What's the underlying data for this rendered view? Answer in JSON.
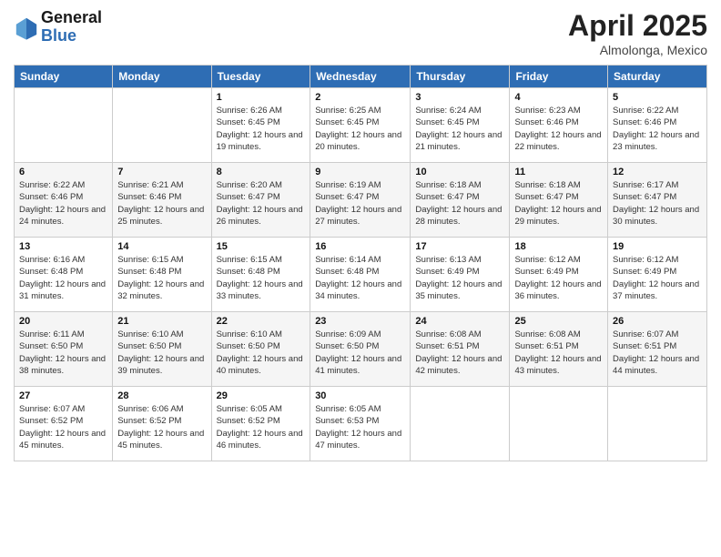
{
  "header": {
    "logo_general": "General",
    "logo_blue": "Blue",
    "month_year": "April 2025",
    "location": "Almolonga, Mexico"
  },
  "days_of_week": [
    "Sunday",
    "Monday",
    "Tuesday",
    "Wednesday",
    "Thursday",
    "Friday",
    "Saturday"
  ],
  "weeks": [
    [
      {
        "day": "",
        "sunrise": "",
        "sunset": "",
        "daylight": ""
      },
      {
        "day": "",
        "sunrise": "",
        "sunset": "",
        "daylight": ""
      },
      {
        "day": "1",
        "sunrise": "Sunrise: 6:26 AM",
        "sunset": "Sunset: 6:45 PM",
        "daylight": "Daylight: 12 hours and 19 minutes."
      },
      {
        "day": "2",
        "sunrise": "Sunrise: 6:25 AM",
        "sunset": "Sunset: 6:45 PM",
        "daylight": "Daylight: 12 hours and 20 minutes."
      },
      {
        "day": "3",
        "sunrise": "Sunrise: 6:24 AM",
        "sunset": "Sunset: 6:45 PM",
        "daylight": "Daylight: 12 hours and 21 minutes."
      },
      {
        "day": "4",
        "sunrise": "Sunrise: 6:23 AM",
        "sunset": "Sunset: 6:46 PM",
        "daylight": "Daylight: 12 hours and 22 minutes."
      },
      {
        "day": "5",
        "sunrise": "Sunrise: 6:22 AM",
        "sunset": "Sunset: 6:46 PM",
        "daylight": "Daylight: 12 hours and 23 minutes."
      }
    ],
    [
      {
        "day": "6",
        "sunrise": "Sunrise: 6:22 AM",
        "sunset": "Sunset: 6:46 PM",
        "daylight": "Daylight: 12 hours and 24 minutes."
      },
      {
        "day": "7",
        "sunrise": "Sunrise: 6:21 AM",
        "sunset": "Sunset: 6:46 PM",
        "daylight": "Daylight: 12 hours and 25 minutes."
      },
      {
        "day": "8",
        "sunrise": "Sunrise: 6:20 AM",
        "sunset": "Sunset: 6:47 PM",
        "daylight": "Daylight: 12 hours and 26 minutes."
      },
      {
        "day": "9",
        "sunrise": "Sunrise: 6:19 AM",
        "sunset": "Sunset: 6:47 PM",
        "daylight": "Daylight: 12 hours and 27 minutes."
      },
      {
        "day": "10",
        "sunrise": "Sunrise: 6:18 AM",
        "sunset": "Sunset: 6:47 PM",
        "daylight": "Daylight: 12 hours and 28 minutes."
      },
      {
        "day": "11",
        "sunrise": "Sunrise: 6:18 AM",
        "sunset": "Sunset: 6:47 PM",
        "daylight": "Daylight: 12 hours and 29 minutes."
      },
      {
        "day": "12",
        "sunrise": "Sunrise: 6:17 AM",
        "sunset": "Sunset: 6:47 PM",
        "daylight": "Daylight: 12 hours and 30 minutes."
      }
    ],
    [
      {
        "day": "13",
        "sunrise": "Sunrise: 6:16 AM",
        "sunset": "Sunset: 6:48 PM",
        "daylight": "Daylight: 12 hours and 31 minutes."
      },
      {
        "day": "14",
        "sunrise": "Sunrise: 6:15 AM",
        "sunset": "Sunset: 6:48 PM",
        "daylight": "Daylight: 12 hours and 32 minutes."
      },
      {
        "day": "15",
        "sunrise": "Sunrise: 6:15 AM",
        "sunset": "Sunset: 6:48 PM",
        "daylight": "Daylight: 12 hours and 33 minutes."
      },
      {
        "day": "16",
        "sunrise": "Sunrise: 6:14 AM",
        "sunset": "Sunset: 6:48 PM",
        "daylight": "Daylight: 12 hours and 34 minutes."
      },
      {
        "day": "17",
        "sunrise": "Sunrise: 6:13 AM",
        "sunset": "Sunset: 6:49 PM",
        "daylight": "Daylight: 12 hours and 35 minutes."
      },
      {
        "day": "18",
        "sunrise": "Sunrise: 6:12 AM",
        "sunset": "Sunset: 6:49 PM",
        "daylight": "Daylight: 12 hours and 36 minutes."
      },
      {
        "day": "19",
        "sunrise": "Sunrise: 6:12 AM",
        "sunset": "Sunset: 6:49 PM",
        "daylight": "Daylight: 12 hours and 37 minutes."
      }
    ],
    [
      {
        "day": "20",
        "sunrise": "Sunrise: 6:11 AM",
        "sunset": "Sunset: 6:50 PM",
        "daylight": "Daylight: 12 hours and 38 minutes."
      },
      {
        "day": "21",
        "sunrise": "Sunrise: 6:10 AM",
        "sunset": "Sunset: 6:50 PM",
        "daylight": "Daylight: 12 hours and 39 minutes."
      },
      {
        "day": "22",
        "sunrise": "Sunrise: 6:10 AM",
        "sunset": "Sunset: 6:50 PM",
        "daylight": "Daylight: 12 hours and 40 minutes."
      },
      {
        "day": "23",
        "sunrise": "Sunrise: 6:09 AM",
        "sunset": "Sunset: 6:50 PM",
        "daylight": "Daylight: 12 hours and 41 minutes."
      },
      {
        "day": "24",
        "sunrise": "Sunrise: 6:08 AM",
        "sunset": "Sunset: 6:51 PM",
        "daylight": "Daylight: 12 hours and 42 minutes."
      },
      {
        "day": "25",
        "sunrise": "Sunrise: 6:08 AM",
        "sunset": "Sunset: 6:51 PM",
        "daylight": "Daylight: 12 hours and 43 minutes."
      },
      {
        "day": "26",
        "sunrise": "Sunrise: 6:07 AM",
        "sunset": "Sunset: 6:51 PM",
        "daylight": "Daylight: 12 hours and 44 minutes."
      }
    ],
    [
      {
        "day": "27",
        "sunrise": "Sunrise: 6:07 AM",
        "sunset": "Sunset: 6:52 PM",
        "daylight": "Daylight: 12 hours and 45 minutes."
      },
      {
        "day": "28",
        "sunrise": "Sunrise: 6:06 AM",
        "sunset": "Sunset: 6:52 PM",
        "daylight": "Daylight: 12 hours and 45 minutes."
      },
      {
        "day": "29",
        "sunrise": "Sunrise: 6:05 AM",
        "sunset": "Sunset: 6:52 PM",
        "daylight": "Daylight: 12 hours and 46 minutes."
      },
      {
        "day": "30",
        "sunrise": "Sunrise: 6:05 AM",
        "sunset": "Sunset: 6:53 PM",
        "daylight": "Daylight: 12 hours and 47 minutes."
      },
      {
        "day": "",
        "sunrise": "",
        "sunset": "",
        "daylight": ""
      },
      {
        "day": "",
        "sunrise": "",
        "sunset": "",
        "daylight": ""
      },
      {
        "day": "",
        "sunrise": "",
        "sunset": "",
        "daylight": ""
      }
    ]
  ]
}
